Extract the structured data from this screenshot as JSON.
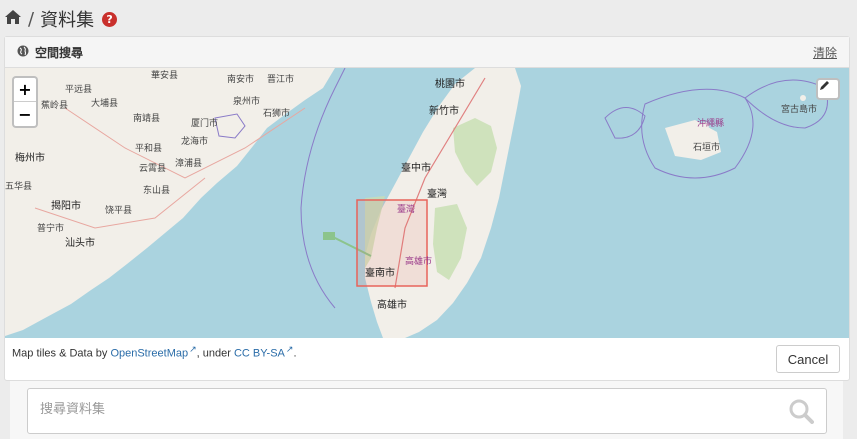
{
  "breadcrumb": {
    "home_icon": "home-icon",
    "separator": "/",
    "title": "資料集",
    "help_icon": "question-circle-icon",
    "help_glyph": "?"
  },
  "panel": {
    "icon": "globe-icon",
    "title": "空間搜尋",
    "clear_label": "清除"
  },
  "map": {
    "zoom_in": "+",
    "zoom_out": "−",
    "edit_icon": "pencil-icon",
    "labels": {
      "l1": "華安县",
      "l2": "南安市",
      "l3": "晋江市",
      "l4": "泉州市",
      "l5": "石狮市",
      "l6": "南靖县",
      "l7": "厦门市",
      "l8": "龙海市",
      "l9": "平和县",
      "l10": "云霄县",
      "l11": "漳浦县",
      "l12": "东山县",
      "l13": "梅州市",
      "l14": "五华县",
      "l15": "揭阳市",
      "l16": "饶平县",
      "l17": "汕头市",
      "l18": "普宁市",
      "l19": "桃園市",
      "l20": "新竹市",
      "l21": "臺中市",
      "l22": "臺灣",
      "l23": "臺灣",
      "l24": "臺南市",
      "l25": "高雄市",
      "l26": "高雄市",
      "l27": "沖繩縣",
      "l28": "石垣市",
      "l29": "宮古島市",
      "l30": "平远县",
      "l31": "蕉岭县",
      "l32": "大埔县"
    },
    "colors": {
      "water": "#aad3df",
      "land": "#f2efe9",
      "forest": "#c9dfb4",
      "selection": "#e8635a"
    }
  },
  "attribution": {
    "prefix": "Map tiles & Data by ",
    "osm_link": "OpenStreetMap",
    "middle": ", under ",
    "license_link": "CC BY-SA",
    "suffix": ".",
    "ext_glyph": "↗"
  },
  "cancel_label": "Cancel",
  "search": {
    "placeholder": "搜尋資料集",
    "icon": "search-icon"
  }
}
